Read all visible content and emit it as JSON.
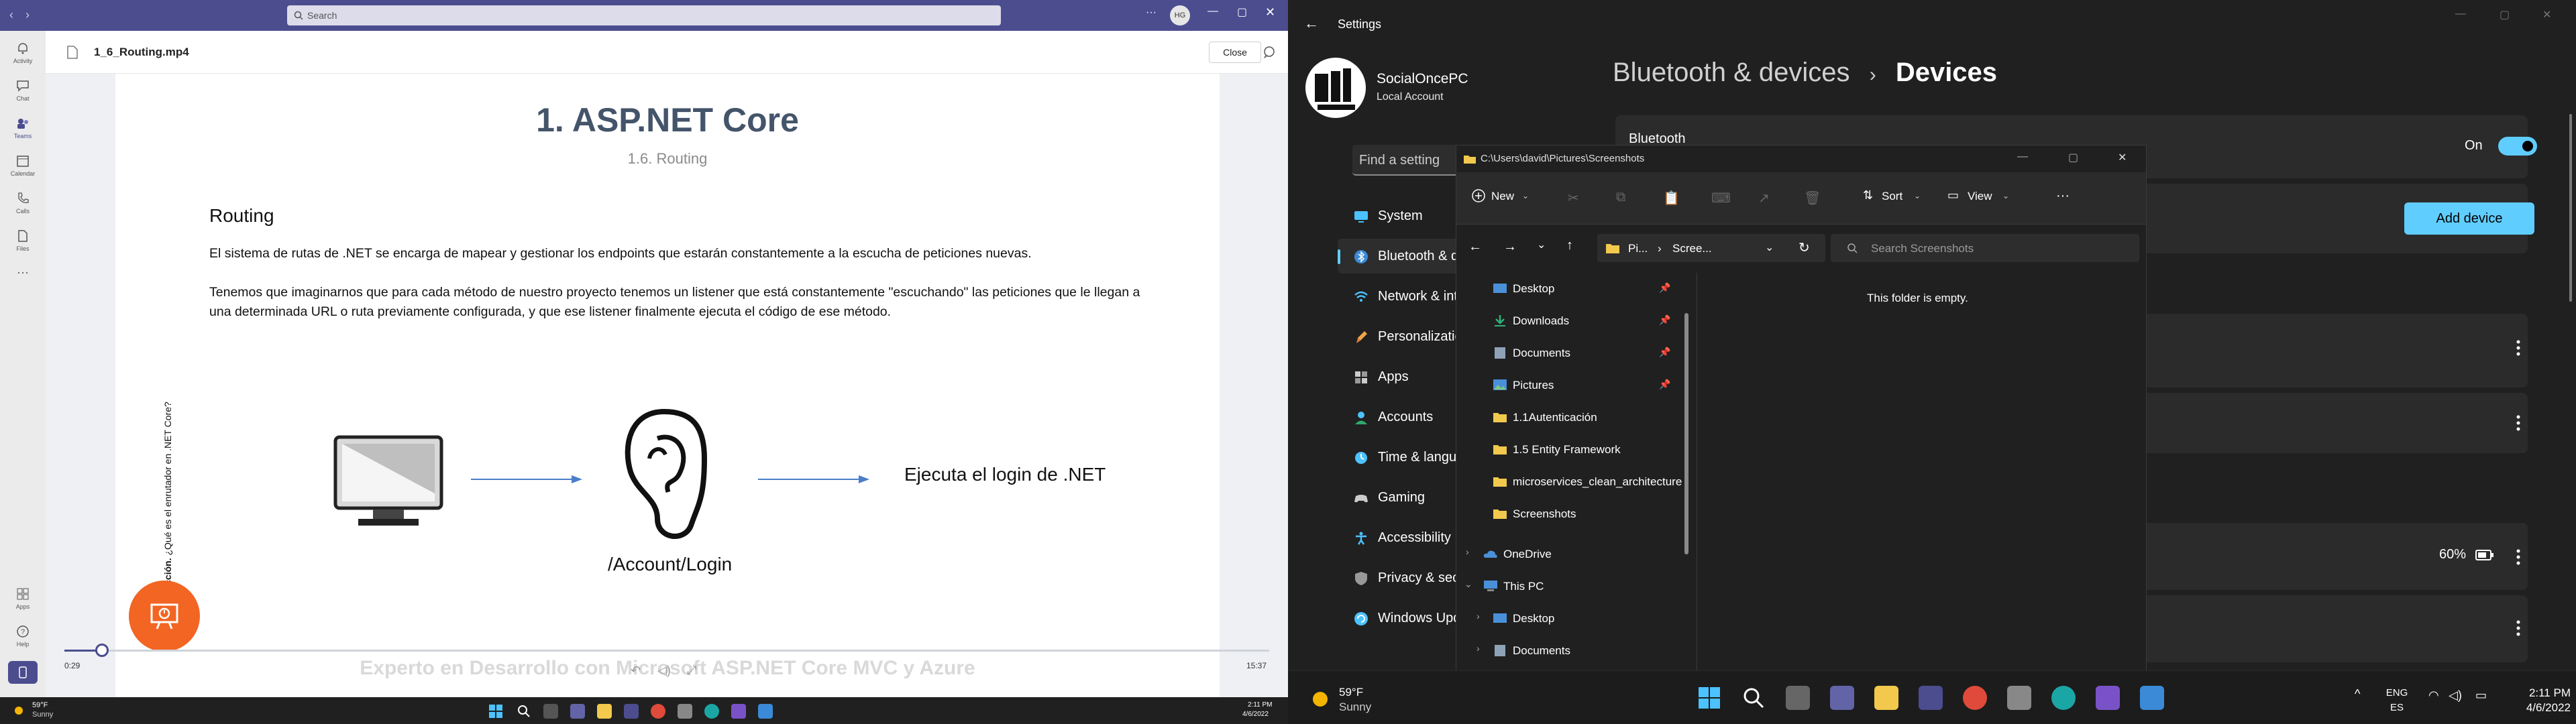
{
  "teams": {
    "search_placeholder": "Search",
    "account_initials": "HG",
    "rail": [
      {
        "label": "Activity"
      },
      {
        "label": "Chat"
      },
      {
        "label": "Teams"
      },
      {
        "label": "Calendar"
      },
      {
        "label": "Calls"
      },
      {
        "label": "Files"
      },
      {
        "label": "Apps"
      },
      {
        "label": "Help"
      }
    ],
    "video_title": "1_6_Routing.mp4",
    "close_label": "Close",
    "slide": {
      "title": "1. ASP.NET Core",
      "subtitle": "1.6. Routing",
      "heading": "Routing",
      "para1": "El sistema de rutas de .NET se encarga de mapear y gestionar los endpoints que estarán constantemente a la escucha de peticiones nuevas.",
      "para2": "Tenemos que imaginarnos que para cada método de nuestro proyecto tenemos un listener que está constantemente \"escuchando\" las peticiones que le llegan a una determinada URL o ruta previamente configurada, y que ese listener finalmente ejecuta el código de ese método.",
      "vertical_bold": "1.6.1. Introducción.",
      "vertical_rest": " ¿Qué es el enrutador en .NET Core?",
      "diagram_right": "Ejecuta el login de .NET",
      "diagram_bottom": "/Account/Login",
      "course_title": "Experto en Desarrollo con Microsoft ASP.NET Core MVC y Azure"
    },
    "time_current": "0:29",
    "time_total": "15:37",
    "progress": 0.031
  },
  "left_taskbar": {
    "temp": "59°F",
    "condition": "Sunny",
    "time": "2:11 PM",
    "date": "4/6/2022"
  },
  "settings": {
    "window_title": "Settings",
    "account_name": "SocialOncePC",
    "account_type": "Local Account",
    "search_placeholder": "Find a setting",
    "nav": [
      {
        "label": "System",
        "icon": "monitor-icon"
      },
      {
        "label": "Bluetooth & devices",
        "icon": "bluetooth-icon"
      },
      {
        "label": "Network & internet",
        "icon": "wifi-icon"
      },
      {
        "label": "Personalization",
        "icon": "brush-icon"
      },
      {
        "label": "Apps",
        "icon": "apps-icon"
      },
      {
        "label": "Accounts",
        "icon": "person-icon"
      },
      {
        "label": "Time & language",
        "icon": "clock-globe-icon"
      },
      {
        "label": "Gaming",
        "icon": "gamepad-icon"
      },
      {
        "label": "Accessibility",
        "icon": "accessibility-icon"
      },
      {
        "label": "Privacy & security",
        "icon": "shield-icon"
      },
      {
        "label": "Windows Update",
        "icon": "update-icon"
      }
    ],
    "breadcrumb_parent": "Bluetooth & devices",
    "breadcrumb_sep": "›",
    "breadcrumb_current": "Devices",
    "bluetooth_label": "Bluetooth",
    "bluetooth_state": "On",
    "add_device_label": "Add device",
    "battery_pct": "60%",
    "accent": "#60cdff"
  },
  "explorer": {
    "path": "C:\\Users\\david\\Pictures\\Screenshots",
    "new_label": "New",
    "sort_label": "Sort",
    "view_label": "View",
    "address_crumbs": [
      "Pi...",
      "›",
      "Scree..."
    ],
    "search_placeholder": "Search Screenshots",
    "empty_message": "This folder is empty.",
    "tree": [
      {
        "label": "Desktop",
        "pinned": true
      },
      {
        "label": "Downloads",
        "pinned": true
      },
      {
        "label": "Documents",
        "pinned": true
      },
      {
        "label": "Pictures",
        "pinned": true
      },
      {
        "label": "1.1Autenticación",
        "pinned": false
      },
      {
        "label": "1.5 Entity Framework",
        "pinned": false
      },
      {
        "label": "microservices_clean_architecture",
        "pinned": false
      },
      {
        "label": "Screenshots",
        "pinned": false
      },
      {
        "label": "OneDrive",
        "pinned": false
      },
      {
        "label": "This PC",
        "pinned": false
      },
      {
        "label": "Desktop",
        "pinned": false
      },
      {
        "label": "Documents",
        "pinned": false
      }
    ]
  },
  "right_taskbar": {
    "temp": "59°F",
    "condition": "Sunny",
    "lang1": "ENG",
    "lang2": "ES",
    "time": "2:11 PM",
    "date": "4/6/2022"
  }
}
